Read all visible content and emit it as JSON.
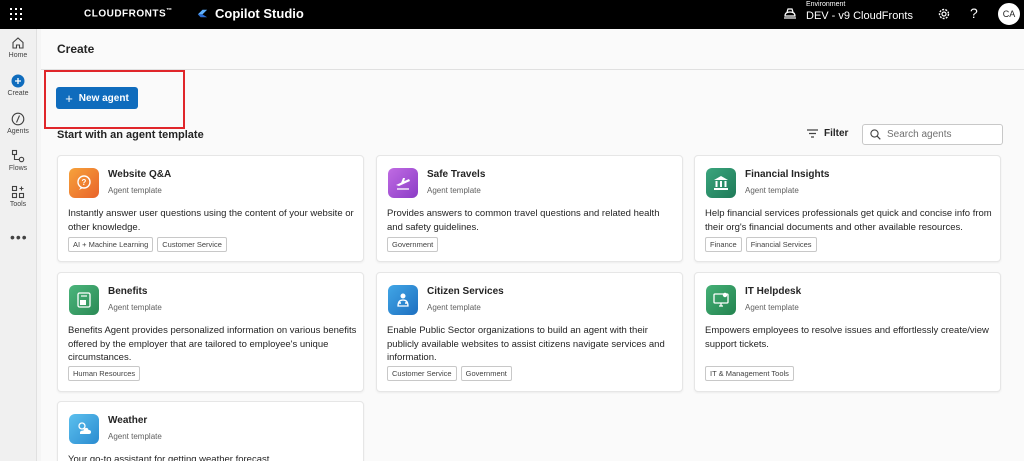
{
  "topbar": {
    "brand": "CLOUDFRONTS",
    "brand_mark": "™",
    "product": "Copilot Studio",
    "environment_label": "Environment",
    "environment_value": "DEV - v9 CloudFronts",
    "help": "?",
    "avatar_initials": "CA"
  },
  "rail": {
    "items": [
      {
        "label": "Home",
        "icon": "home-icon"
      },
      {
        "label": "Create",
        "icon": "plus-circle-icon"
      },
      {
        "label": "Agents",
        "icon": "agents-icon"
      },
      {
        "label": "Flows",
        "icon": "flows-icon"
      },
      {
        "label": "Tools",
        "icon": "tools-icon"
      }
    ],
    "more": "•••"
  },
  "page": {
    "title": "Create",
    "new_agent_label": "New agent",
    "section_title": "Start with an agent template",
    "filter_label": "Filter",
    "search_placeholder": "Search agents"
  },
  "templates": [
    {
      "name": "Website Q&A",
      "subtitle": "Agent template",
      "description": "Instantly answer user questions using the content of your website or other knowledge.",
      "tags": [
        "AI + Machine Learning",
        "Customer Service"
      ],
      "color": "#f0873a"
    },
    {
      "name": "Safe Travels",
      "subtitle": "Agent template",
      "description": "Provides answers to common travel questions and related health and safety guidelines.",
      "tags": [
        "Government"
      ],
      "color": "#a24fd1"
    },
    {
      "name": "Financial Insights",
      "subtitle": "Agent template",
      "description": "Help financial services professionals get quick and concise info from their org's financial documents and other available resources.",
      "tags": [
        "Finance",
        "Financial Services"
      ],
      "color": "#2e8b6a"
    },
    {
      "name": "Benefits",
      "subtitle": "Agent template",
      "description": "Benefits Agent provides personalized information on various benefits offered by the employer that are tailored to employee's unique circumstances.",
      "tags": [
        "Human Resources"
      ],
      "color": "#3ea26d"
    },
    {
      "name": "Citizen Services",
      "subtitle": "Agent template",
      "description": "Enable Public Sector organizations to build an agent with their publicly available websites to assist citizens navigate services and information.",
      "tags": [
        "Customer Service",
        "Government"
      ],
      "color": "#2b8fd6"
    },
    {
      "name": "IT Helpdesk",
      "subtitle": "Agent template",
      "description": "Empowers employees to resolve issues and effortlessly create/view support tickets.",
      "tags": [
        "IT & Management Tools"
      ],
      "color": "#2f9a5e"
    },
    {
      "name": "Weather",
      "subtitle": "Agent template",
      "description": "Your go-to assistant for getting weather forecast.",
      "tags": [],
      "color": "#3aa7e0"
    }
  ]
}
